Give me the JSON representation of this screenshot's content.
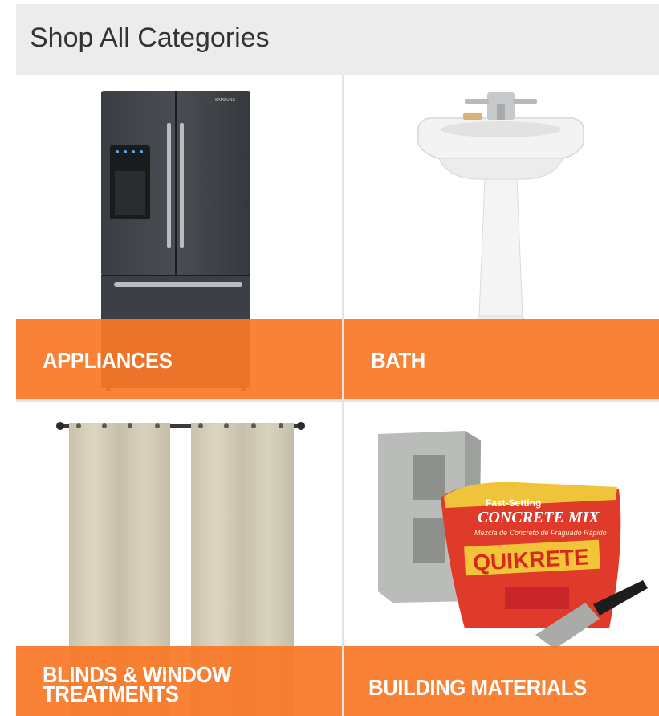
{
  "header": {
    "title": "Shop All Categories"
  },
  "categories": [
    {
      "label": "APPLIANCES",
      "image": "refrigerator"
    },
    {
      "label": "BATH",
      "image": "pedestal-sink"
    },
    {
      "label": "BLINDS & WINDOW\nTREATMENTS",
      "image": "curtains"
    },
    {
      "label": "BUILDING MATERIALS",
      "image": "cinder-block-and-concrete-mix"
    }
  ],
  "product_text": {
    "fridge_brand": "SAMSUNG",
    "bag_top": "Fast-Setting",
    "bag_title": "CONCRETE MIX",
    "bag_spanish": "Mezcla de Concreto de Fraguado Rápido",
    "bag_brand": "QUIKRETE"
  },
  "colors": {
    "accent": "#f97828",
    "header_bg": "#ececec"
  }
}
